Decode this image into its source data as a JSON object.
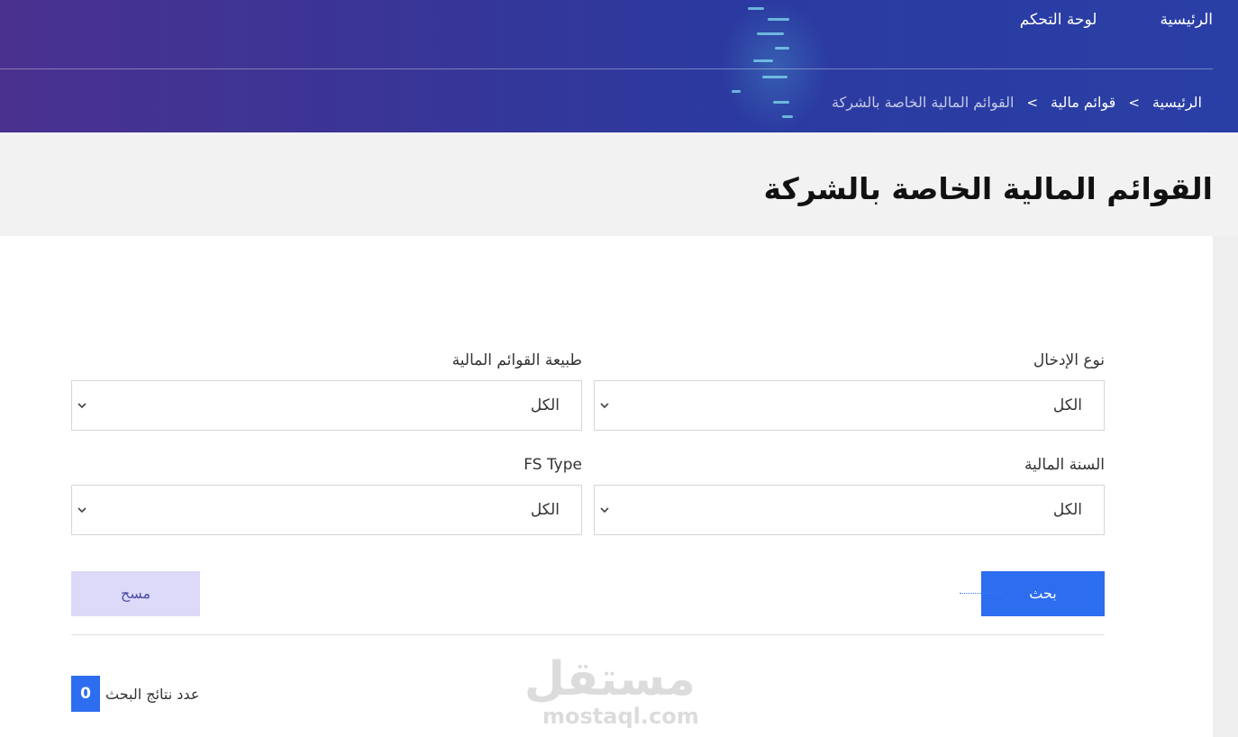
{
  "nav": {
    "home": "الرئيسية",
    "dashboard": "لوحة التحكم"
  },
  "breadcrumb": {
    "home": "الرئيسية",
    "sep": ">",
    "financial_lists": "قوائم مالية",
    "current": "القوائم المالية الخاصة بالشركة"
  },
  "page": {
    "title": "القوائم المالية الخاصة بالشركة"
  },
  "filters": {
    "entry_type": {
      "label": "نوع الإدخال",
      "value": "الكل"
    },
    "statement_nature": {
      "label": "طبيعة القوائم المالية",
      "value": "الكل"
    },
    "fiscal_year": {
      "label": "السنة المالية",
      "value": "الكل"
    },
    "fs_type": {
      "label": "FS Type",
      "value": "الكل"
    }
  },
  "actions": {
    "search": "بحث",
    "clear": "مسح"
  },
  "results": {
    "label": "عدد نتائج البحث",
    "count": "0"
  },
  "watermark": {
    "ar": "مستقل",
    "en": "mostaql.com"
  },
  "colors": {
    "header_start": "#4a3190",
    "header_end": "#2a3fa6",
    "primary": "#2d6df0",
    "clear_bg": "#dcdaf8"
  }
}
